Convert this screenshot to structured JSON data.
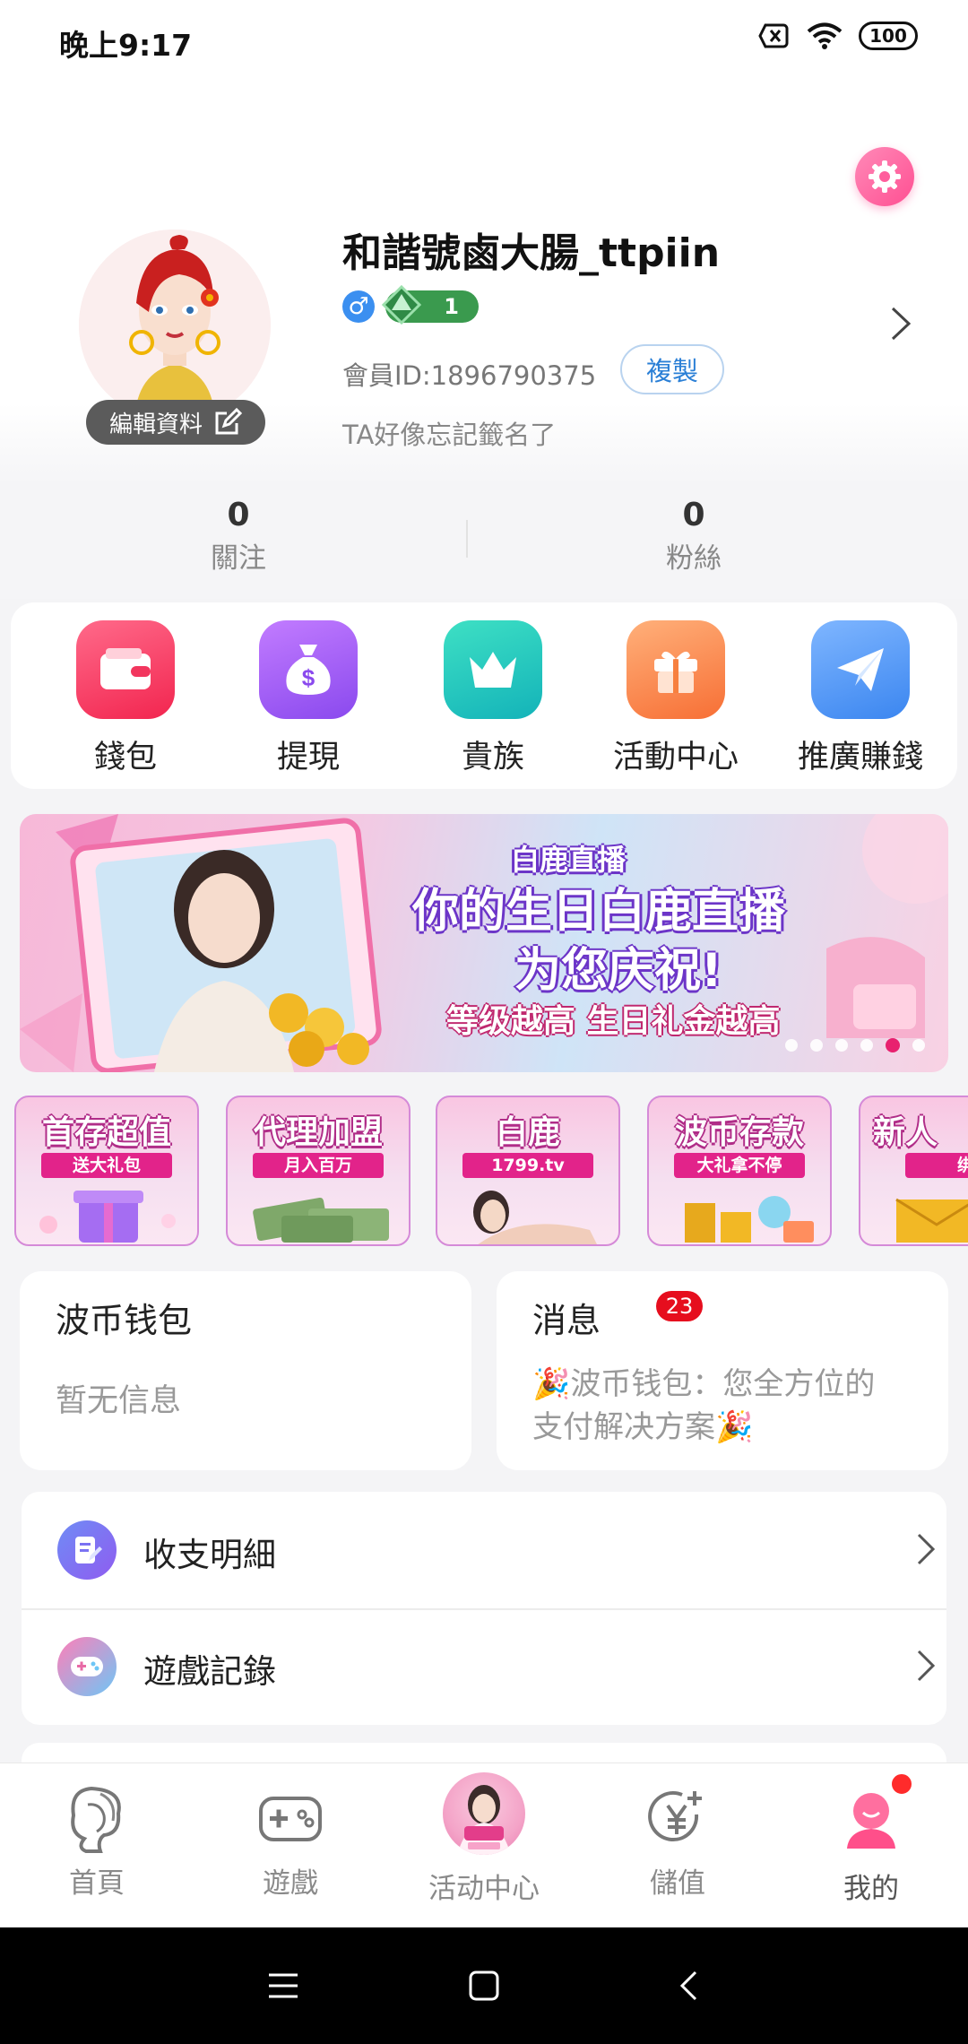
{
  "status_bar": {
    "time": "晚上9:17",
    "battery": "100"
  },
  "profile": {
    "username": "和諧號鹵大腸_ttpiin",
    "gender_symbol": "♂",
    "level": "1",
    "member_id": "會員ID:1896790375",
    "copy_label": "複製",
    "signature": "TA好像忘記籤名了",
    "edit_label": "編輯資料"
  },
  "stats": {
    "following": {
      "value": "0",
      "label": "關注"
    },
    "fans": {
      "value": "0",
      "label": "粉絲"
    }
  },
  "quick_actions": [
    {
      "label": "錢包",
      "icon": "wallet-icon",
      "color": "#f2365e"
    },
    {
      "label": "提現",
      "icon": "money-bag-icon",
      "color": "#9b5cf0"
    },
    {
      "label": "貴族",
      "icon": "crown-icon",
      "color": "#1fc8b8"
    },
    {
      "label": "活動中心",
      "icon": "gift-icon",
      "color": "#fb8a45"
    },
    {
      "label": "推廣賺錢",
      "icon": "paper-plane-icon",
      "color": "#4d94f6"
    }
  ],
  "banner": {
    "brand": "白鹿直播",
    "headline": "你的生日白鹿直播",
    "headline2": "为您庆祝!",
    "subline": "等级越高 生日礼金越高",
    "slide_count": 6,
    "active_slide": 4
  },
  "promos": [
    {
      "title": "首存超值",
      "subtitle": "送大礼包"
    },
    {
      "title": "代理加盟",
      "subtitle": "月入百万"
    },
    {
      "title": "白鹿",
      "subtitle": "1799.tv"
    },
    {
      "title": "波币存款",
      "subtitle": "大礼拿不停"
    },
    {
      "title": "新人",
      "subtitle": "绑定手机"
    }
  ],
  "wallet_card": {
    "title": "波币钱包",
    "body": "暂无信息"
  },
  "message_card": {
    "title": "消息",
    "badge": "23",
    "line1": "🎉波币钱包：您全方位的",
    "line2": "支付解决方案🎉"
  },
  "list": [
    {
      "label": "收支明細",
      "icon": "document-edit-icon"
    },
    {
      "label": "遊戲記錄",
      "icon": "gamepad-icon"
    }
  ],
  "tabbar": [
    {
      "label": "首頁",
      "icon": "woman-profile-icon",
      "active": false
    },
    {
      "label": "遊戲",
      "icon": "gamepad-icon",
      "active": false
    },
    {
      "label": "活动中心",
      "icon": "center-avatar-icon",
      "active": false
    },
    {
      "label": "儲值",
      "icon": "yuan-plus-icon",
      "active": false
    },
    {
      "label": "我的",
      "icon": "user-icon",
      "active": true
    }
  ],
  "colors": {
    "accent": "#ff4f92",
    "link": "#2a7fd6",
    "badge_red": "#e60e1e"
  }
}
